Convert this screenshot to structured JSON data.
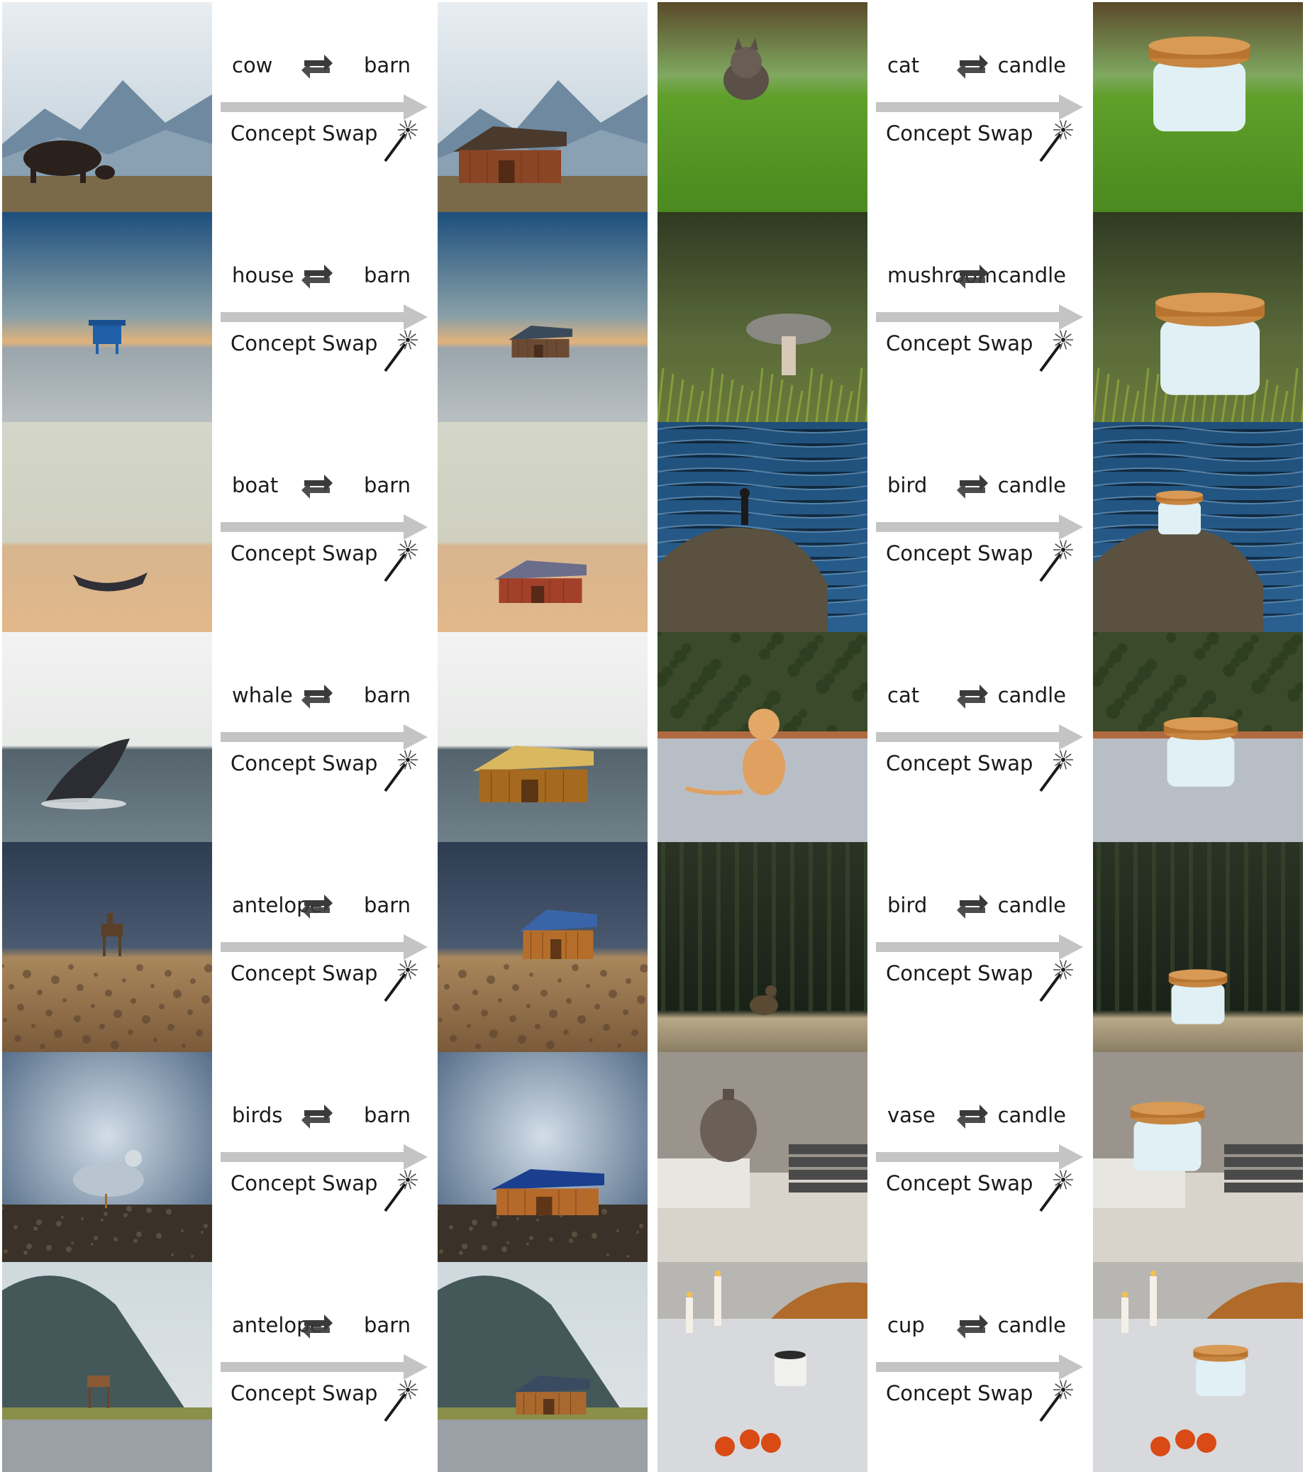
{
  "action_label": "Concept Swap",
  "icons": {
    "swap": "swap-arrows-icon",
    "wand": "magic-wand-icon",
    "arrow": "right-arrow-icon"
  },
  "left": {
    "target": "barn",
    "rows": [
      {
        "source": "cow",
        "scene": "mountain-pasture"
      },
      {
        "source": "house",
        "scene": "beach-dusk"
      },
      {
        "source": "boat",
        "scene": "sand-beach"
      },
      {
        "source": "whale",
        "scene": "ocean"
      },
      {
        "source": "antelope",
        "scene": "rocky-field"
      },
      {
        "source": "birds",
        "scene": "rocky-shore"
      },
      {
        "source": "antelope",
        "scene": "coastal-road"
      }
    ]
  },
  "right": {
    "target": "candle",
    "rows": [
      {
        "source": "cat",
        "scene": "grass-lawn"
      },
      {
        "source": "mushroom",
        "scene": "mossy-forest"
      },
      {
        "source": "bird",
        "scene": "rock-water"
      },
      {
        "source": "cat",
        "scene": "hedge-pavement"
      },
      {
        "source": "bird",
        "scene": "dark-trees"
      },
      {
        "source": "vase",
        "scene": "shelf-books"
      },
      {
        "source": "cup",
        "scene": "table-candles"
      }
    ]
  }
}
